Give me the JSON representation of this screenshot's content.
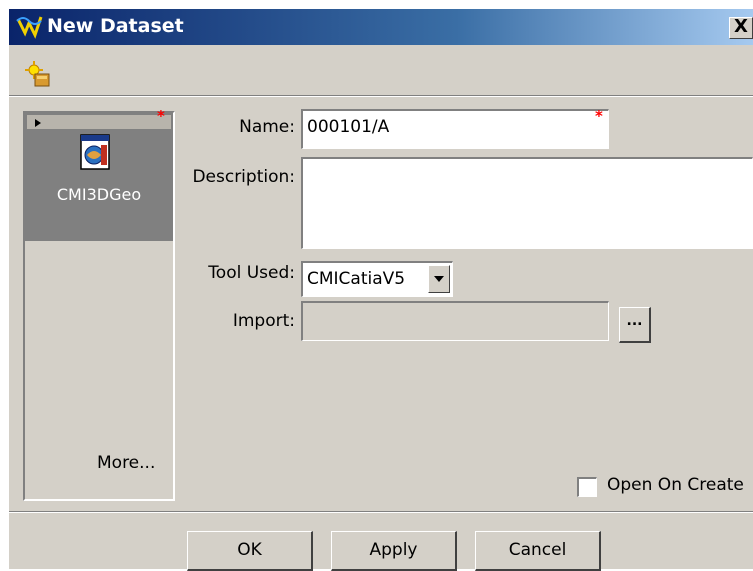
{
  "window": {
    "title": "New Dataset",
    "close_label": "X"
  },
  "types_panel": {
    "selected_type": "CMI3DGeo",
    "more_label": "More...",
    "required_marker": "*"
  },
  "form": {
    "name_label": "Name:",
    "name_value": "000101/A",
    "name_required_marker": "*",
    "description_label": "Description:",
    "description_value": "",
    "tool_used_label": "Tool Used:",
    "tool_used_value": "CMICatiaV5",
    "import_label": "Import:",
    "import_value": "",
    "browse_label": "...",
    "open_on_create_label": "Open On Create",
    "open_on_create_checked": false
  },
  "buttons": {
    "ok": "OK",
    "apply": "Apply",
    "cancel": "Cancel"
  },
  "icons": {
    "app": "teamcenter-app-icon",
    "toolbar": "new-wizard-icon",
    "dataset_type": "cmi3dgeo-dataset-icon",
    "browse": "ellipsis-icon",
    "dropdown": "chevron-down-icon"
  },
  "colors": {
    "title_gradient_start": "#0a246a",
    "title_gradient_end": "#a6caf0",
    "dialog_bg": "#d4d0c8",
    "selected_item_bg": "#808080",
    "required_marker": "#ff0000"
  }
}
